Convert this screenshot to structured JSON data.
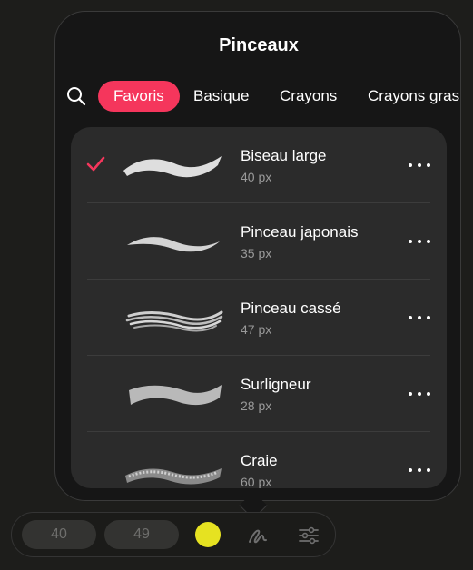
{
  "popover": {
    "title": "Pinceaux",
    "tabs": [
      {
        "label": "Favoris",
        "active": true
      },
      {
        "label": "Basique",
        "active": false
      },
      {
        "label": "Crayons",
        "active": false
      },
      {
        "label": "Crayons gras",
        "active": false
      }
    ],
    "brushes": [
      {
        "name": "Biseau large",
        "size": "40 px",
        "selected": true,
        "preview": "flat-wave-stroke"
      },
      {
        "name": "Pinceau japonais",
        "size": "35 px",
        "selected": false,
        "preview": "tapered-stroke"
      },
      {
        "name": "Pinceau cassé",
        "size": "47 px",
        "selected": false,
        "preview": "streaked-stroke"
      },
      {
        "name": "Surligneur",
        "size": "28 px",
        "selected": false,
        "preview": "soft-highlighter-stroke"
      },
      {
        "name": "Craie",
        "size": "60 px",
        "selected": false,
        "preview": "chalk-stroke"
      }
    ]
  },
  "toolbar": {
    "size_value": "40",
    "opacity_value": "49",
    "current_color": "#e6e221",
    "icons": [
      "brush-tool-icon",
      "sliders-icon"
    ]
  },
  "colors": {
    "accent": "#f5365c",
    "background": "#1d1d1b",
    "panel": "#2b2b2b"
  }
}
